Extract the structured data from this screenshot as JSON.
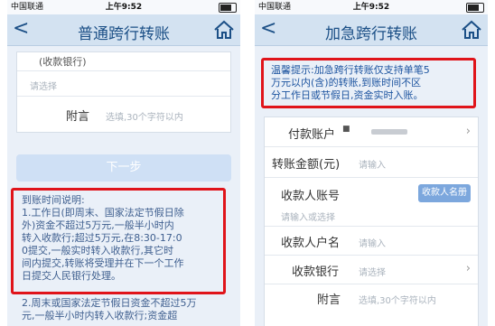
{
  "left": {
    "status": {
      "carrier": "中国联通",
      "time": "上午9:52"
    },
    "nav": {
      "back": "<",
      "title": "普通跨行转账"
    },
    "form": {
      "cut_label": "(收款银行)",
      "cut_placeholder": "请选择",
      "memo_label": "附言",
      "memo_placeholder": "选填,30个字符以内"
    },
    "next_button": "下一步",
    "notice": {
      "title": "到账时间说明:",
      "lines": [
        "1.工作日(即周末、国家法定节假日除",
        "外)资金不超过5万元,一般半小时内",
        "转入收款行;超过5万元,在8:30-17:0",
        "0提交,一般实时转入收款行,其它时",
        "间内提交,转账将受理并在下一个工作",
        "日提交人民银行处理。"
      ],
      "below_lines": [
        "2.周末或国家法定节假日资金不超过5万",
        "元,一般半小时内转入收款行;资金超"
      ]
    }
  },
  "right": {
    "status": {
      "carrier": "中国联通",
      "time": "上午9:52"
    },
    "nav": {
      "back": "<",
      "title": "加急跨行转账"
    },
    "notice": {
      "lines": [
        "温馨提示:加急跨行转账仅支持单笔5",
        "万元以内(含)的转账,到账时间不区",
        "分工作日或节假日,资金实时入账。"
      ]
    },
    "form": {
      "pay_account_label": "付款账户",
      "pay_account_value": "■",
      "amount_label": "转账金额(元)",
      "amount_placeholder": "请输入",
      "payee_account_label": "收款人账号",
      "payee_list_button": "收款人名册",
      "payee_account_placeholder": "请输入或选择",
      "payee_name_label": "收款人户名",
      "payee_name_placeholder": "请输入",
      "bank_label": "收款银行",
      "bank_placeholder": "请选择",
      "memo_label": "附言",
      "memo_placeholder": "选填,30个字符以内"
    }
  }
}
